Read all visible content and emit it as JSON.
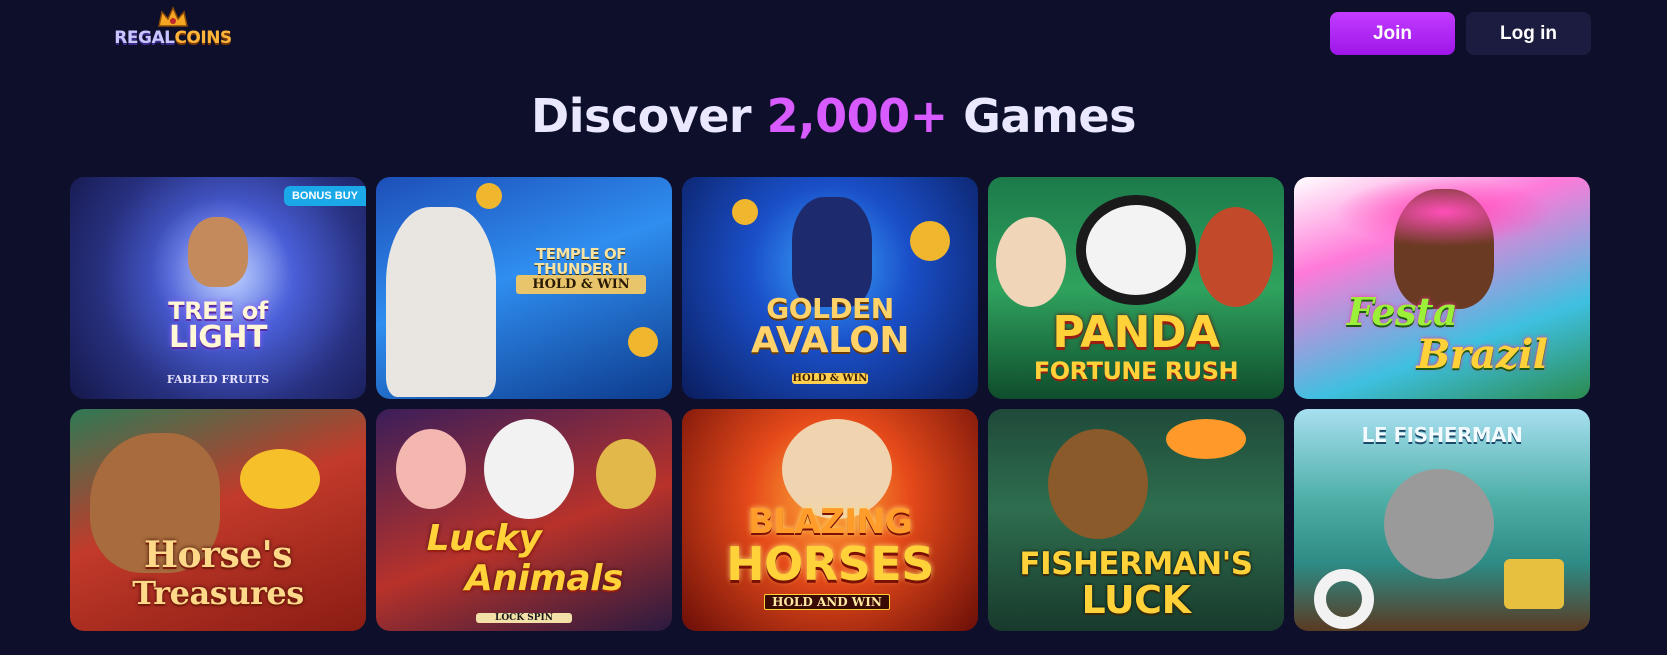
{
  "header": {
    "logo_part1": "REGAL",
    "logo_part2": "COINS",
    "join_label": "Join",
    "login_label": "Log in"
  },
  "headline": {
    "prefix": "Discover ",
    "highlight": "2,000+",
    "suffix": " Games"
  },
  "colors": {
    "background": "#0e0f2b",
    "accent": "#d75bff",
    "join_button": "#b026f5",
    "login_button": "#1b1c40",
    "badge": "#1aa8e8"
  },
  "games": [
    {
      "title_line1": "TREE of",
      "title_line2": "LIGHT",
      "subtitle": "FABLED FRUITS",
      "badge": "BONUS BUY"
    },
    {
      "title_line1": "TEMPLE OF THUNDER II",
      "subtitle": "HOLD & WIN"
    },
    {
      "title_line1": "GOLDEN",
      "title_line2": "AVALON",
      "subtitle": "HOLD & WIN"
    },
    {
      "title_line1": "PANDA",
      "title_line2": "FORTUNE RUSH"
    },
    {
      "title_line1": "Festa",
      "title_line2": "Brazil"
    },
    {
      "title_line1": "Horse's",
      "title_line2": "Treasures"
    },
    {
      "title_line1": "Lucky",
      "title_line2": "Animals",
      "subtitle": "LOCK SPIN"
    },
    {
      "title_line1": "BLAZING",
      "title_line2": "HORSES",
      "subtitle": "HOLD AND WIN"
    },
    {
      "title_line1": "FISHERMAN'S",
      "title_line2": "LUCK"
    },
    {
      "title_line1": "LE FISHERMAN"
    }
  ]
}
